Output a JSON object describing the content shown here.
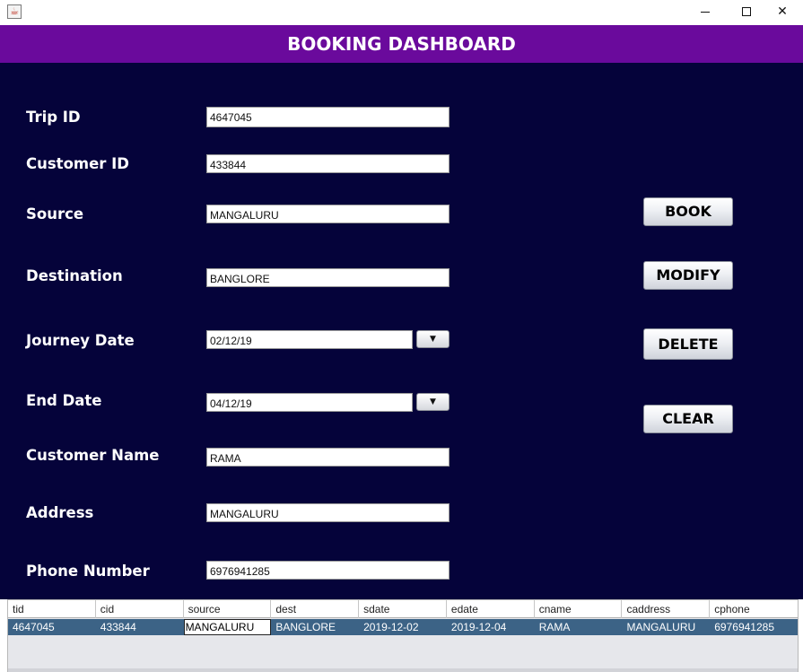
{
  "window": {
    "app_icon": "java-cup-icon",
    "controls": {
      "minimize": "minimize-icon",
      "maximize": "maximize-icon",
      "close": "✕"
    }
  },
  "header": {
    "title": "BOOKING DASHBOARD"
  },
  "colors": {
    "header_bg": "#6a0a9c",
    "panel_bg": "#05033a",
    "row_selected": "#3c6386"
  },
  "form": {
    "trip_id": {
      "label": "Trip ID",
      "value": "4647045"
    },
    "customer_id": {
      "label": "Customer ID",
      "value": "433844"
    },
    "source": {
      "label": "Source",
      "value": "MANGALURU"
    },
    "destination": {
      "label": "Destination",
      "value": "BANGLORE"
    },
    "journey_date": {
      "label": "Journey Date",
      "value": "02/12/19",
      "button": "▼"
    },
    "end_date": {
      "label": "End Date",
      "value": "04/12/19",
      "button": "▼"
    },
    "customer_name": {
      "label": "Customer Name",
      "value": "RAMA"
    },
    "address": {
      "label": "Address",
      "value": "MANGALURU"
    },
    "phone": {
      "label": "Phone Number",
      "value": "6976941285"
    }
  },
  "actions": {
    "book": "BOOK",
    "modify": "MODIFY",
    "delete": "DELETE",
    "clear": "CLEAR"
  },
  "table": {
    "columns": [
      "tid",
      "cid",
      "source",
      "dest",
      "sdate",
      "edate",
      "cname",
      "caddress",
      "cphone"
    ],
    "rows": [
      [
        "4647045",
        "433844",
        "MANGALURU",
        "BANGLORE",
        "2019-12-02",
        "2019-12-04",
        "RAMA",
        "MANGALURU",
        "6976941285"
      ]
    ]
  }
}
